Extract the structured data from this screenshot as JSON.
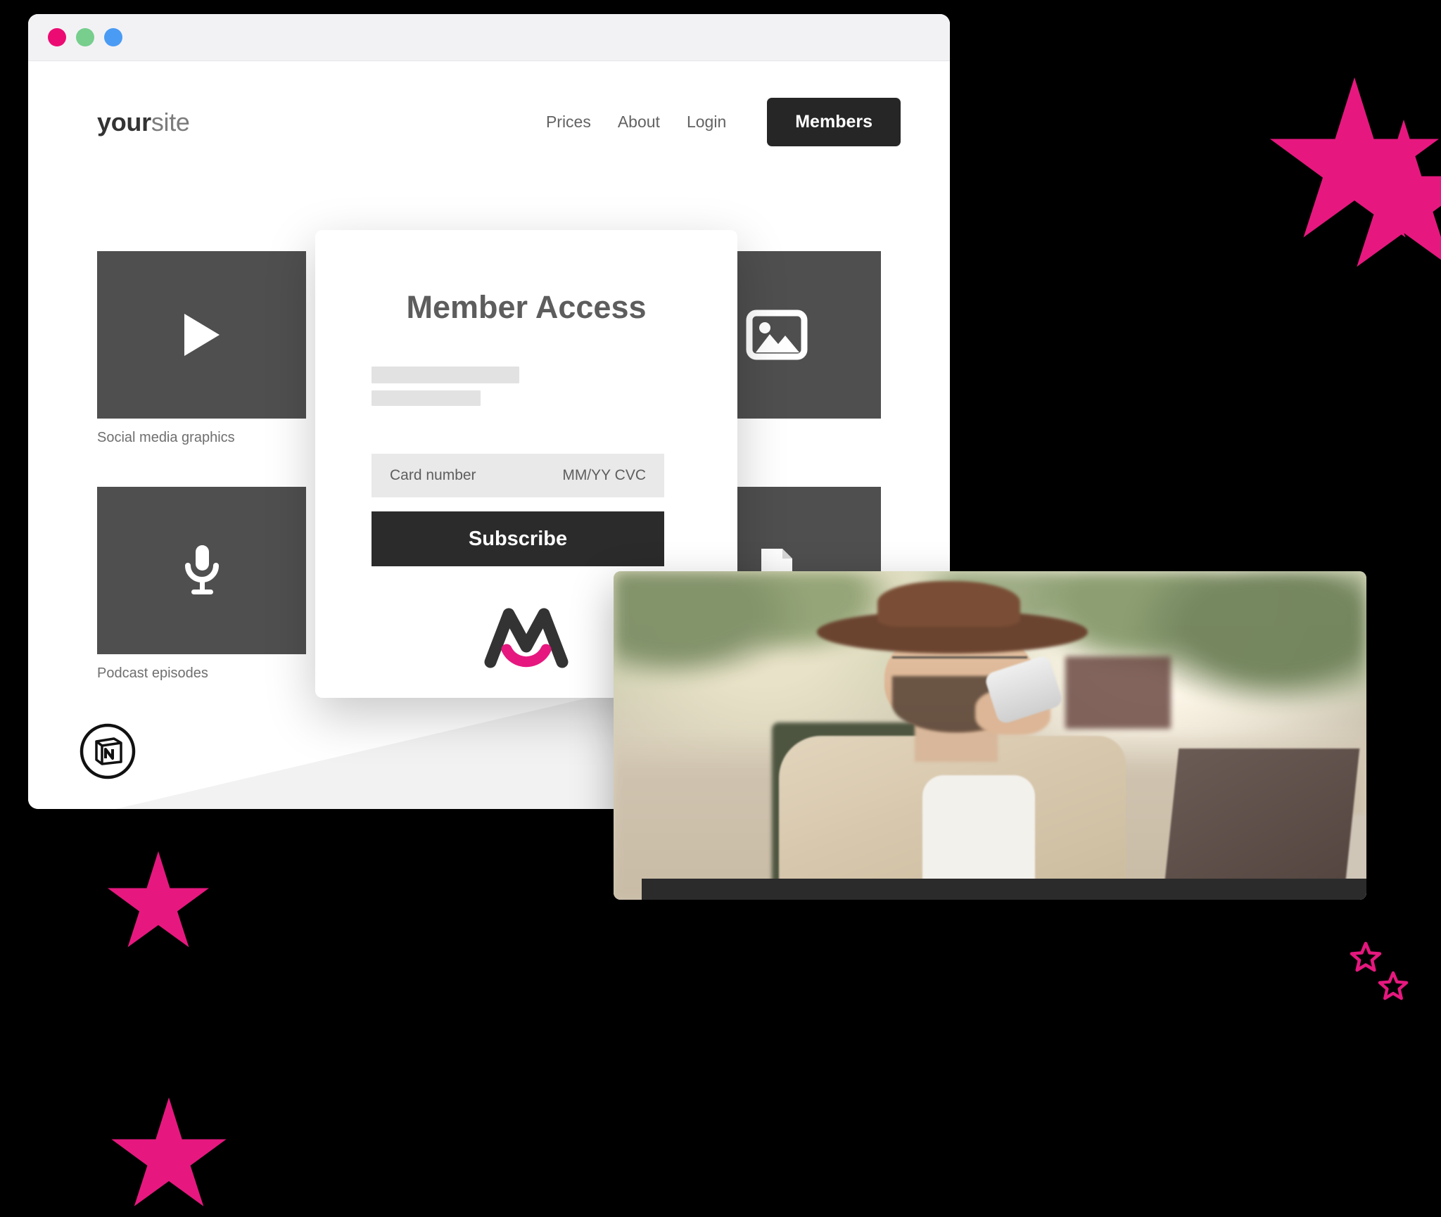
{
  "window": {
    "traffic_lights": [
      "close",
      "minimize",
      "maximize"
    ]
  },
  "site": {
    "logo_bold": "your",
    "logo_light": "site",
    "nav": [
      {
        "label": "Prices",
        "name": "nav-link-prices"
      },
      {
        "label": "About",
        "name": "nav-link-about"
      },
      {
        "label": "Login",
        "name": "nav-link-login"
      }
    ],
    "cta_label": "Members"
  },
  "content_cards": [
    {
      "label": "Social media graphics",
      "icon": "play-icon"
    },
    {
      "label": "",
      "icon": "image-icon"
    },
    {
      "label": "Podcast episodes",
      "icon": "microphone-icon"
    },
    {
      "label": "",
      "icon": "document-icon"
    }
  ],
  "modal": {
    "title": "Member Access",
    "card_number_placeholder": "Card number",
    "card_expiry_cvc_placeholder": "MM/YY CVC",
    "subscribe_label": "Subscribe",
    "brand_logo": "memberful-m-logo"
  },
  "badges": {
    "notion": "notion-logo"
  },
  "photo": {
    "alt": "man-in-hat-drinking-coffee-with-laptop-outdoors"
  },
  "colors": {
    "accent_pink": "#e6187f",
    "dot_pink": "#ec0b72",
    "dot_green": "#77ce8d",
    "dot_blue": "#4a9bf4",
    "dark": "#262626",
    "thumb_gray": "#4f4f4f",
    "skeleton_gray": "#e2e2e2",
    "field_gray": "#e9e9e9"
  }
}
